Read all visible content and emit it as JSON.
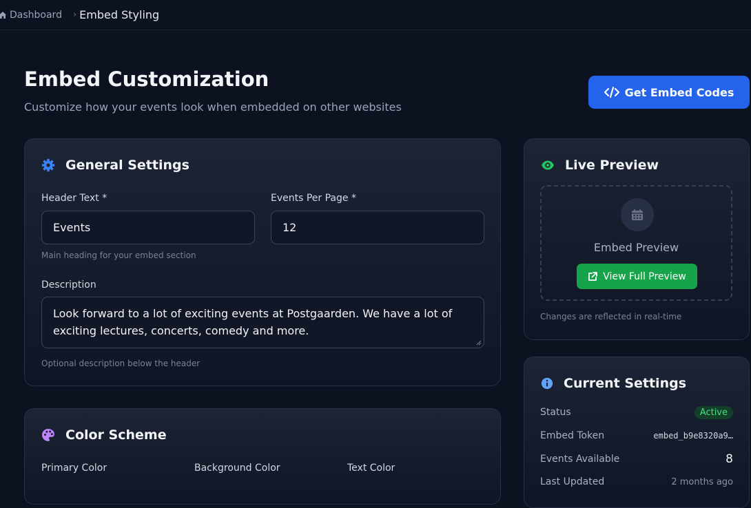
{
  "breadcrumb": {
    "home_label": "Dashboard",
    "current_label": "Embed Styling"
  },
  "header": {
    "title": "Embed Customization",
    "subtitle": "Customize how your events look when embedded on other websites",
    "embed_codes_label": "Get Embed Codes"
  },
  "general": {
    "title": "General Settings",
    "header_text_label": "Header Text *",
    "header_text_value": "Events",
    "header_text_hint": "Main heading for your embed section",
    "events_per_page_label": "Events Per Page *",
    "events_per_page_value": "12",
    "description_label": "Description",
    "description_value": "Look forward to a lot of exciting events at Postgaarden. We have a lot of exciting lectures, concerts, comedy and more.",
    "description_hint": "Optional description below the header"
  },
  "colors": {
    "title": "Color Scheme",
    "primary_label": "Primary Color",
    "background_label": "Background Color",
    "text_label": "Text Color"
  },
  "live_preview": {
    "title": "Live Preview",
    "placeholder_text": "Embed Preview",
    "view_full_label": "View Full Preview",
    "footnote": "Changes are reflected in real-time"
  },
  "current_settings": {
    "title": "Current Settings",
    "status_label": "Status",
    "status_value": "Active",
    "token_label": "Embed Token",
    "token_value": "embed_b9e8320a9…",
    "events_label": "Events Available",
    "events_value": "8",
    "updated_label": "Last Updated",
    "updated_value": "2 months ago"
  },
  "theme": {
    "accent": "#2563eb",
    "success": "#16a34a",
    "background": "#0d1220"
  },
  "icons": {
    "home": "home-icon",
    "embed": "code-icon",
    "general": "gear-icon",
    "colors": "palette-icon",
    "preview": "eye-icon",
    "calendar": "calendar-icon",
    "external": "external-link-icon",
    "info": "info-icon"
  }
}
